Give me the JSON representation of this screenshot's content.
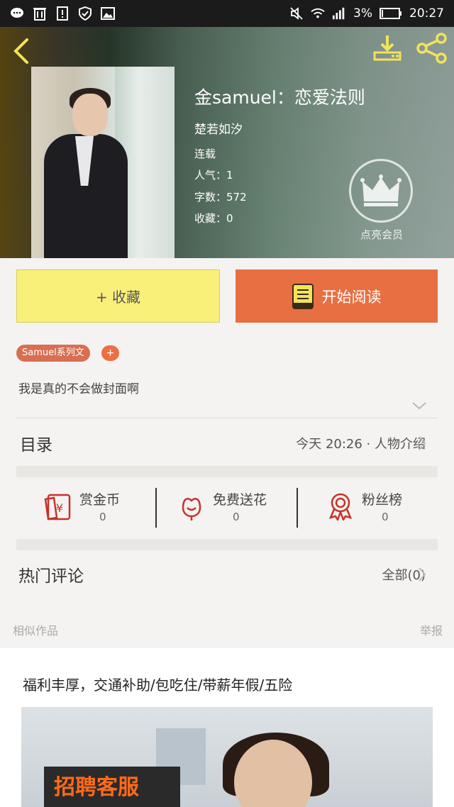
{
  "status_bar": {
    "battery": "3%",
    "time": "20:27"
  },
  "book": {
    "title": "金samuel：恋爱法则",
    "author": "楚若如汐",
    "status": "连载",
    "popularity": "人气：1",
    "word_count": "字数：572",
    "favorites": "收藏：0",
    "vip_label": "点亮会员",
    "description": "我是真的不会做封面啊"
  },
  "actions": {
    "favorite": "+ 收藏",
    "read": "开始阅读"
  },
  "tags": {
    "series": "Samuel系列文",
    "add": "+"
  },
  "toc": {
    "label": "目录",
    "latest": "今天 20:26 · 人物介绍"
  },
  "stats": [
    {
      "label": "赏金币",
      "count": "0",
      "icon": "coin-envelope-icon"
    },
    {
      "label": "免费送花",
      "count": "0",
      "icon": "flower-icon"
    },
    {
      "label": "粉丝榜",
      "count": "0",
      "icon": "ribbon-badge-icon"
    }
  ],
  "comments": {
    "label": "热门评论",
    "all": "全部(0)"
  },
  "similar": {
    "label": "相似作品",
    "report": "举报"
  },
  "ad": {
    "text": "福利丰厚，交通补助/包吃住/带薪年假/五险",
    "badge": "招聘客服"
  },
  "colors": {
    "accent": "#e86f42",
    "favorite_bg": "#f9f07a",
    "tag_bg": "#d86f52"
  }
}
